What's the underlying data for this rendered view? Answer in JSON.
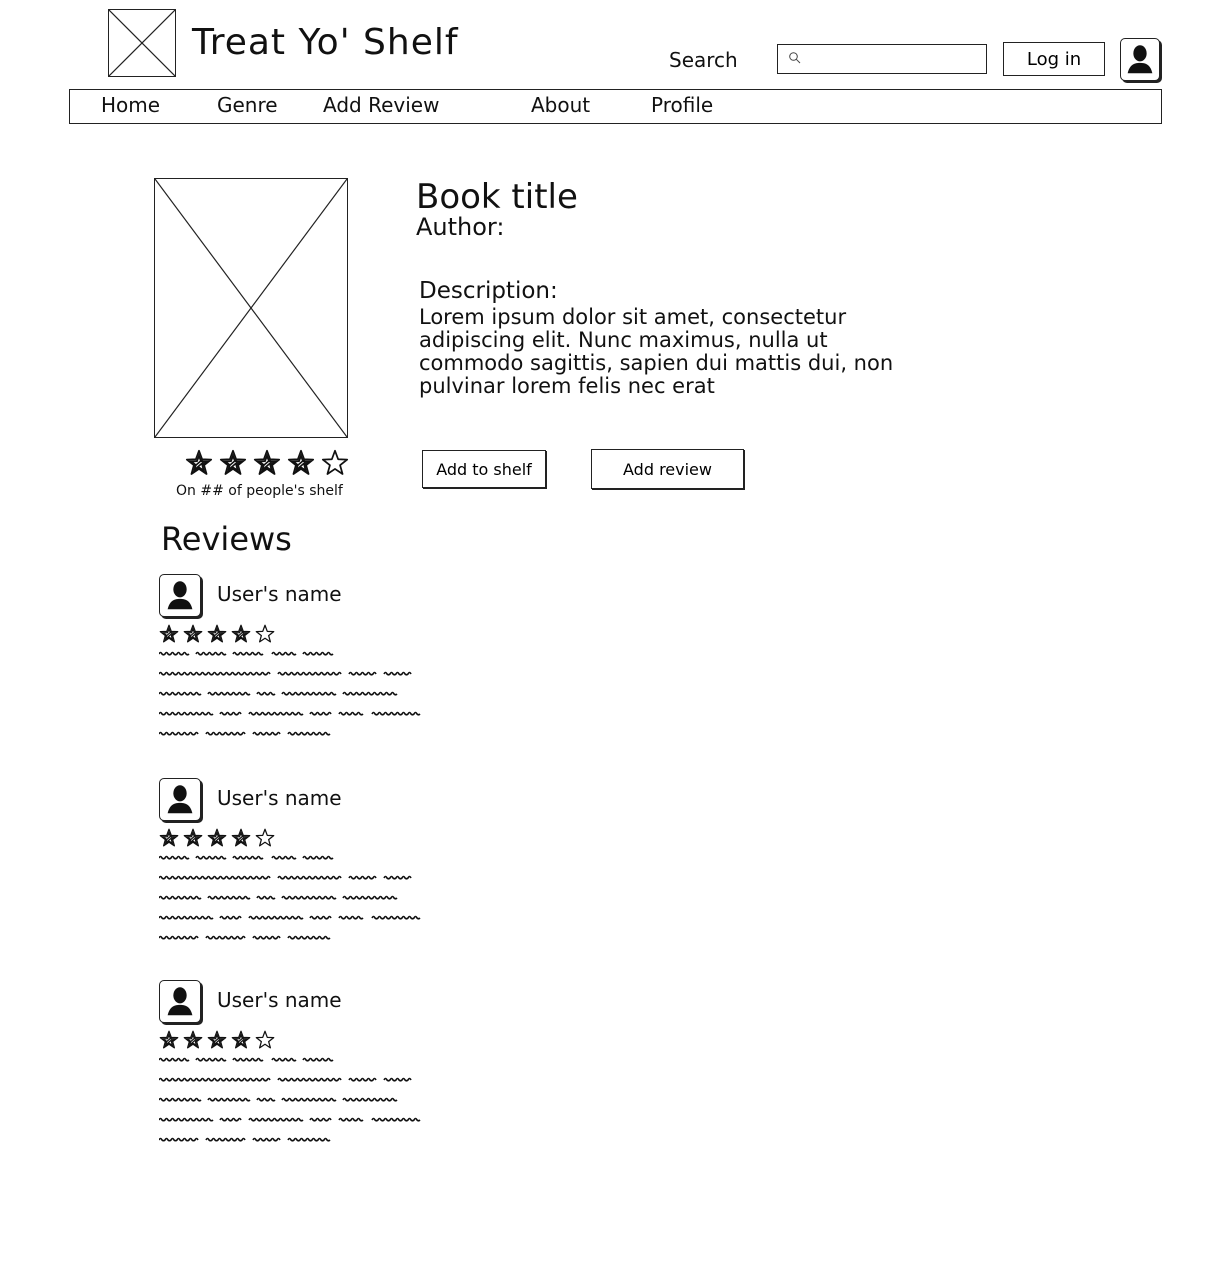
{
  "header": {
    "logo_icon": "image-placeholder-icon",
    "brand_title": "Treat Yo' Shelf",
    "search_label": "Search",
    "search_placeholder": "",
    "search_icon": "magnifier-icon",
    "login_label": "Log in",
    "avatar_icon": "user-silhouette-icon"
  },
  "nav": {
    "items": [
      {
        "label": "Home"
      },
      {
        "label": "Genre"
      },
      {
        "label": "Add Review"
      },
      {
        "label": "About"
      },
      {
        "label": "Profile"
      }
    ]
  },
  "book": {
    "cover_icon": "image-placeholder-icon",
    "title": "Book title",
    "author_label": "Author:",
    "description_label": "Description:",
    "description": "Lorem ipsum dolor sit amet, consectetur adipiscing elit. Nunc maximus, nulla ut commodo sagittis, sapien dui mattis dui, non pulvinar lorem felis nec erat",
    "rating": {
      "filled": 4,
      "max": 5
    },
    "shelf_count_text": "On ## of people's shelf",
    "add_to_shelf_label": "Add to shelf",
    "add_review_label": "Add review"
  },
  "reviews": {
    "heading": "Reviews",
    "items": [
      {
        "user_name": "User's name",
        "rating_filled": 4,
        "rating_max": 5
      },
      {
        "user_name": "User's name",
        "rating_filled": 4,
        "rating_max": 5
      },
      {
        "user_name": "User's name",
        "rating_filled": 4,
        "rating_max": 5
      }
    ]
  },
  "colors": {
    "ink": "#222222",
    "background": "#ffffff"
  }
}
